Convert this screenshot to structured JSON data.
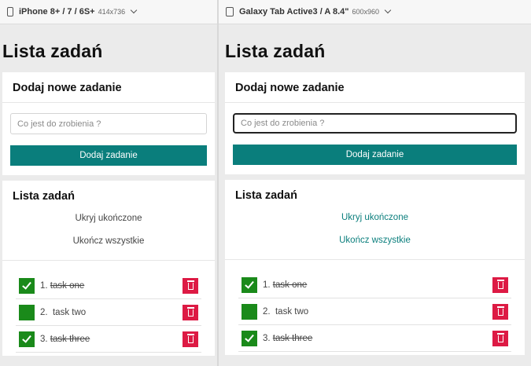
{
  "devices": [
    {
      "name": "iPhone 8+ / 7 / 6S+",
      "size": "414x736",
      "app": {
        "title": "Lista zadań",
        "add_card": {
          "heading": "Dodaj nowe zadanie",
          "input_placeholder": "Co jest do zrobienia ?",
          "button_label": "Dodaj zadanie"
        },
        "list_card": {
          "heading": "Lista zadań",
          "hide_completed_label": "Ukryj ukończone",
          "complete_all_label": "Ukończ wszystkie",
          "tasks": [
            {
              "number": "1.",
              "label": "task one",
              "done": true
            },
            {
              "number": "2.",
              "label": "task two",
              "done": false
            },
            {
              "number": "3.",
              "label": "task three",
              "done": true
            }
          ]
        }
      }
    },
    {
      "name": "Galaxy Tab Active3 / A 8.4\"",
      "size": "600x960",
      "app": {
        "title": "Lista zadań",
        "add_card": {
          "heading": "Dodaj nowe zadanie",
          "input_placeholder": "Co jest do zrobienia ?",
          "button_label": "Dodaj zadanie"
        },
        "list_card": {
          "heading": "Lista zadań",
          "hide_completed_label": "Ukryj ukończone",
          "complete_all_label": "Ukończ wszystkie",
          "tasks": [
            {
              "number": "1.",
              "label": "task one",
              "done": true
            },
            {
              "number": "2.",
              "label": "task two",
              "done": false
            },
            {
              "number": "3.",
              "label": "task three",
              "done": true
            }
          ]
        }
      }
    }
  ],
  "colors": {
    "accent": "#0a7e7c",
    "check": "#1a8a1a",
    "delete": "#dd1a44"
  },
  "icons": {
    "device": "phone-icon",
    "dropdown": "chevron-down-icon",
    "check": "checkmark-icon",
    "delete": "trash-icon"
  }
}
